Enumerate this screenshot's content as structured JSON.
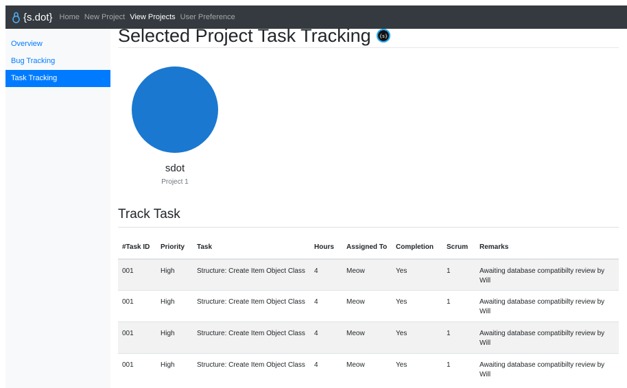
{
  "navbar": {
    "brand": "{s.dot}",
    "links": [
      {
        "label": "Home",
        "active": false
      },
      {
        "label": "New Project",
        "active": false
      },
      {
        "label": "View Projects",
        "active": true
      },
      {
        "label": "User Preference",
        "active": false
      }
    ]
  },
  "sidebar": {
    "items": [
      {
        "label": "Overview",
        "active": false
      },
      {
        "label": "Bug Tracking",
        "active": false
      },
      {
        "label": "Task Tracking",
        "active": true
      }
    ]
  },
  "main": {
    "page_title": "Selected Project Task Tracking",
    "title_badge": "{s}",
    "project": {
      "name": "sdot",
      "subtitle": "Project 1",
      "avatar_color": "#1b78d0"
    },
    "section_title": "Track Task",
    "table": {
      "headers": {
        "task_id": "#Task ID",
        "priority": "Priority",
        "task": "Task",
        "hours": "Hours",
        "assigned": "Assigned To",
        "completion": "Completion",
        "scrum": "Scrum",
        "remarks": "Remarks"
      },
      "rows": [
        {
          "task_id": "001",
          "priority": "High",
          "task": "Structure: Create Item Object Class",
          "hours": "4",
          "assigned": "Meow",
          "completion": "Yes",
          "scrum": "1",
          "remarks": "Awaiting database compatibilty review by Will"
        },
        {
          "task_id": "001",
          "priority": "High",
          "task": "Structure: Create Item Object Class",
          "hours": "4",
          "assigned": "Meow",
          "completion": "Yes",
          "scrum": "1",
          "remarks": "Awaiting database compatibilty review by Will"
        },
        {
          "task_id": "001",
          "priority": "High",
          "task": "Structure: Create Item Object Class",
          "hours": "4",
          "assigned": "Meow",
          "completion": "Yes",
          "scrum": "1",
          "remarks": "Awaiting database compatibilty review by Will"
        },
        {
          "task_id": "001",
          "priority": "High",
          "task": "Structure: Create Item Object Class",
          "hours": "4",
          "assigned": "Meow",
          "completion": "Yes",
          "scrum": "1",
          "remarks": "Awaiting database compatibilty review by Will"
        }
      ]
    }
  },
  "colors": {
    "navbar_bg": "#343a40",
    "accent": "#007bff",
    "sidebar_bg": "#f8f9fa"
  }
}
